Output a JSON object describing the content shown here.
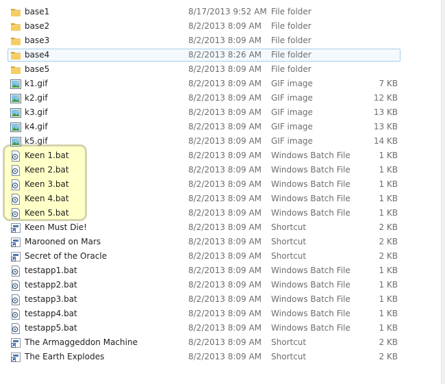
{
  "files": [
    {
      "name": "base1",
      "date": "8/17/2013 9:52 AM",
      "type": "File folder",
      "size": "",
      "icon": "folder-icon"
    },
    {
      "name": "base2",
      "date": "8/2/2013 8:09 AM",
      "type": "File folder",
      "size": "",
      "icon": "folder-icon"
    },
    {
      "name": "base3",
      "date": "8/2/2013 8:09 AM",
      "type": "File folder",
      "size": "",
      "icon": "folder-icon"
    },
    {
      "name": "base4",
      "date": "8/2/2013 8:26 AM",
      "type": "File folder",
      "size": "",
      "icon": "folder-icon",
      "selected": true
    },
    {
      "name": "base5",
      "date": "8/2/2013 8:09 AM",
      "type": "File folder",
      "size": "",
      "icon": "folder-icon"
    },
    {
      "name": "k1.gif",
      "date": "8/2/2013 8:09 AM",
      "type": "GIF image",
      "size": "7 KB",
      "icon": "gif-image-icon"
    },
    {
      "name": "k2.gif",
      "date": "8/2/2013 8:09 AM",
      "type": "GIF image",
      "size": "12 KB",
      "icon": "gif-image-icon"
    },
    {
      "name": "k3.gif",
      "date": "8/2/2013 8:09 AM",
      "type": "GIF image",
      "size": "13 KB",
      "icon": "gif-image-icon"
    },
    {
      "name": "k4.gif",
      "date": "8/2/2013 8:09 AM",
      "type": "GIF image",
      "size": "13 KB",
      "icon": "gif-image-icon"
    },
    {
      "name": "k5.gif",
      "date": "8/2/2013 8:09 AM",
      "type": "GIF image",
      "size": "14 KB",
      "icon": "gif-image-icon"
    },
    {
      "name": "Keen 1.bat",
      "date": "8/2/2013 8:09 AM",
      "type": "Windows Batch File",
      "size": "1 KB",
      "icon": "batch-file-icon"
    },
    {
      "name": "Keen 2.bat",
      "date": "8/2/2013 8:09 AM",
      "type": "Windows Batch File",
      "size": "1 KB",
      "icon": "batch-file-icon"
    },
    {
      "name": "Keen 3.bat",
      "date": "8/2/2013 8:09 AM",
      "type": "Windows Batch File",
      "size": "1 KB",
      "icon": "batch-file-icon"
    },
    {
      "name": "Keen 4.bat",
      "date": "8/2/2013 8:09 AM",
      "type": "Windows Batch File",
      "size": "1 KB",
      "icon": "batch-file-icon"
    },
    {
      "name": "Keen 5.bat",
      "date": "8/2/2013 8:09 AM",
      "type": "Windows Batch File",
      "size": "1 KB",
      "icon": "batch-file-icon"
    },
    {
      "name": "Keen Must Die!",
      "date": "8/2/2013 8:09 AM",
      "type": "Shortcut",
      "size": "2 KB",
      "icon": "shortcut-icon"
    },
    {
      "name": "Marooned on Mars",
      "date": "8/2/2013 8:09 AM",
      "type": "Shortcut",
      "size": "2 KB",
      "icon": "shortcut-icon"
    },
    {
      "name": "Secret of the Oracle",
      "date": "8/2/2013 8:09 AM",
      "type": "Shortcut",
      "size": "2 KB",
      "icon": "shortcut-icon"
    },
    {
      "name": "testapp1.bat",
      "date": "8/2/2013 8:09 AM",
      "type": "Windows Batch File",
      "size": "1 KB",
      "icon": "batch-file-icon"
    },
    {
      "name": "testapp2.bat",
      "date": "8/2/2013 8:09 AM",
      "type": "Windows Batch File",
      "size": "1 KB",
      "icon": "batch-file-icon"
    },
    {
      "name": "testapp3.bat",
      "date": "8/2/2013 8:09 AM",
      "type": "Windows Batch File",
      "size": "1 KB",
      "icon": "batch-file-icon"
    },
    {
      "name": "testapp4.bat",
      "date": "8/2/2013 8:09 AM",
      "type": "Windows Batch File",
      "size": "1 KB",
      "icon": "batch-file-icon"
    },
    {
      "name": "testapp5.bat",
      "date": "8/2/2013 8:09 AM",
      "type": "Windows Batch File",
      "size": "1 KB",
      "icon": "batch-file-icon"
    },
    {
      "name": "The Armaggeddon Machine",
      "date": "8/2/2013 8:09 AM",
      "type": "Shortcut",
      "size": "2 KB",
      "icon": "shortcut-icon"
    },
    {
      "name": "The Earth Explodes",
      "date": "8/2/2013 8:09 AM",
      "type": "Shortcut",
      "size": "2 KB",
      "icon": "shortcut-icon"
    }
  ],
  "colors": {
    "highlight_fill": "#ffffc8",
    "highlight_border": "#d3d3ad",
    "selection_border": "#a5cdeb",
    "folder": "#e8b54a"
  }
}
